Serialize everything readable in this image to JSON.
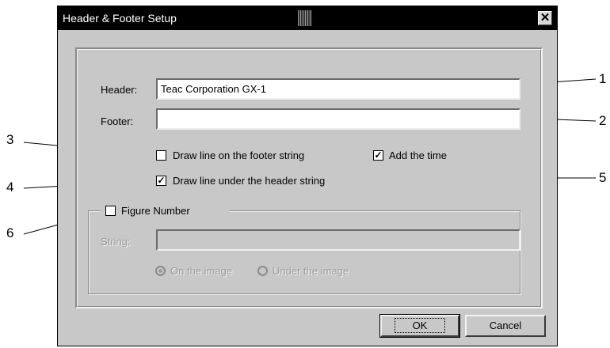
{
  "window": {
    "title": "Header & Footer Setup",
    "close_glyph": "✕"
  },
  "header": {
    "label": "Header:",
    "value": "Teac Corporation GX-1"
  },
  "footer": {
    "label": "Footer:",
    "value": ""
  },
  "options": {
    "draw_footer_line": {
      "label": "Draw line on the footer string",
      "checked": false
    },
    "draw_header_line": {
      "label": "Draw line under the header string",
      "checked": true
    },
    "add_time": {
      "label": "Add the time",
      "checked": true
    }
  },
  "figure_number": {
    "label": "Figure Number",
    "checked": false,
    "string_label": "String:",
    "string_value": "",
    "radio_on_image": {
      "label": "On the image",
      "selected": true
    },
    "radio_under_image": {
      "label": "Under the image",
      "selected": false
    }
  },
  "buttons": {
    "ok": "OK",
    "cancel": "Cancel"
  },
  "callouts": [
    "1",
    "2",
    "3",
    "4",
    "5",
    "6"
  ],
  "colors": {
    "dialog_bg": "#c8c8c8",
    "titlebar_bg": "#000000",
    "titlebar_text": "#ffffff"
  }
}
